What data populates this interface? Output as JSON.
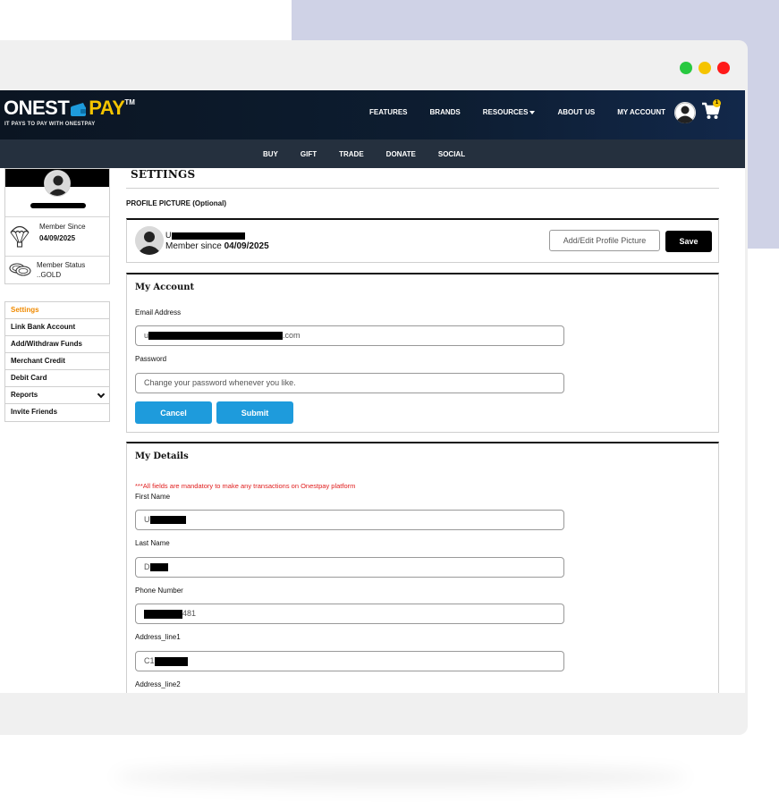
{
  "window": {
    "controls": [
      {
        "name": "maximize",
        "color": "#28c940"
      },
      {
        "name": "minimize",
        "color": "#f5c400"
      },
      {
        "name": "close",
        "color": "#ff1a1a"
      }
    ]
  },
  "header": {
    "logo_part1": "ONEST",
    "logo_part2": "PAY",
    "logo_tm": "TM",
    "tagline": "IT PAYS TO PAY WITH ONESTPAY",
    "nav": [
      "FEATURES",
      "BRANDS",
      "RESOURCES",
      "ABOUT US",
      "MY ACCOUNT"
    ],
    "cart_count": "1"
  },
  "subnav": [
    "BUY",
    "GIFT",
    "TRADE",
    "DONATE",
    "SOCIAL"
  ],
  "sidebar": {
    "member_since_label": "Member Since",
    "member_since_value": "04/09/2025",
    "member_status_label": "Member Status",
    "member_status_value": "..GOLD",
    "menu": [
      "Settings",
      "Link Bank Account",
      "Add/Withdraw Funds",
      "Merchant Credit",
      "Debit Card",
      "Reports",
      "Invite Friends"
    ]
  },
  "settings": {
    "title": "SETTINGS",
    "profile_picture_label": "PROFILE PICTURE (Optional)",
    "profile": {
      "name_initial": "U",
      "member_since_prefix": "Member since",
      "member_since_date": "04/09/2025",
      "edit_button": "Add/Edit Profile Picture",
      "save_button": "Save"
    },
    "my_account": {
      "title": "My Account",
      "email_label": "Email Address",
      "email_prefix": "u",
      "email_suffix": ".com",
      "password_label": "Password",
      "password_placeholder": "Change your password whenever you like.",
      "cancel_button": "Cancel",
      "submit_button": "Submit"
    },
    "my_details": {
      "title": "My Details",
      "notice": "***All fields are mandatory to make any transactions on Onestpay platform",
      "first_name_label": "First Name",
      "first_name_prefix": "U",
      "last_name_label": "Last Name",
      "last_name_prefix": "D",
      "phone_label": "Phone Number",
      "phone_suffix": "481",
      "address1_label": "Address_line1",
      "address1_prefix": "C1",
      "address2_label": "Address_line2"
    }
  }
}
